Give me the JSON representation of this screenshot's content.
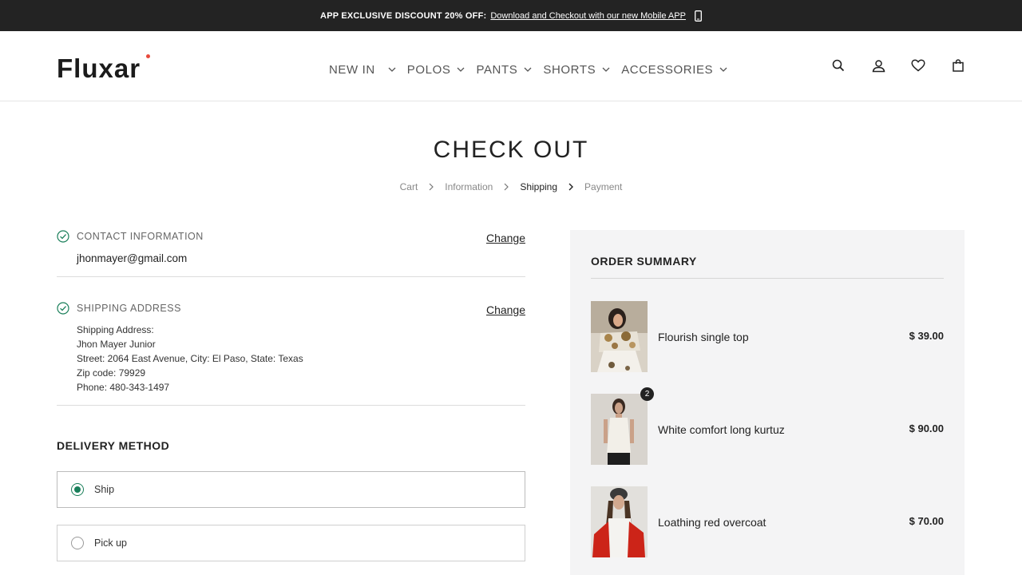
{
  "promo": {
    "label": "APP EXCLUSIVE DISCOUNT 20% OFF:",
    "link": "Download and Checkout with our new Mobile APP",
    "icon": "phone-icon"
  },
  "header": {
    "logo": "Fluxar",
    "nav": [
      {
        "label": "NEW IN"
      },
      {
        "label": "POLOS"
      },
      {
        "label": "PANTS"
      },
      {
        "label": "SHORTS"
      },
      {
        "label": "ACCESSORIES"
      }
    ],
    "icons": [
      "search-icon",
      "account-icon",
      "wishlist-icon",
      "bag-icon"
    ]
  },
  "page": {
    "title": "CHECK OUT",
    "breadcrumbs": [
      "Cart",
      "Information",
      "Shipping",
      "Payment"
    ],
    "active_step": "Shipping"
  },
  "contact": {
    "title": "CONTACT INFORMATION",
    "change": "Change",
    "email": "jhonmayer@gmail.com"
  },
  "shipping": {
    "title": "SHIPPING ADDRESS",
    "change": "Change",
    "lines": [
      "Shipping Address:",
      "Jhon Mayer Junior",
      "Street: 2064 East Avenue, City: El Paso, State: Texas",
      "Zip code: 79929",
      "Phone: 480-343-1497"
    ]
  },
  "delivery": {
    "title": "DELIVERY METHOD",
    "options": [
      {
        "label": "Ship",
        "selected": true
      },
      {
        "label": "Pick up",
        "selected": false
      }
    ]
  },
  "summary": {
    "title": "ORDER SUMMARY",
    "items": [
      {
        "name": "Flourish single top",
        "price": "$ 39.00",
        "qty": ""
      },
      {
        "name": "White comfort long kurtuz",
        "price": "$ 90.00",
        "qty": "2"
      },
      {
        "name": "Loathing red overcoat",
        "price": "$ 70.00",
        "qty": ""
      }
    ]
  },
  "colors": {
    "promo_bg": "#232323",
    "accent_green": "#1a7f5a",
    "logo_dot": "#e84a3c",
    "summary_bg": "#f4f4f5"
  }
}
